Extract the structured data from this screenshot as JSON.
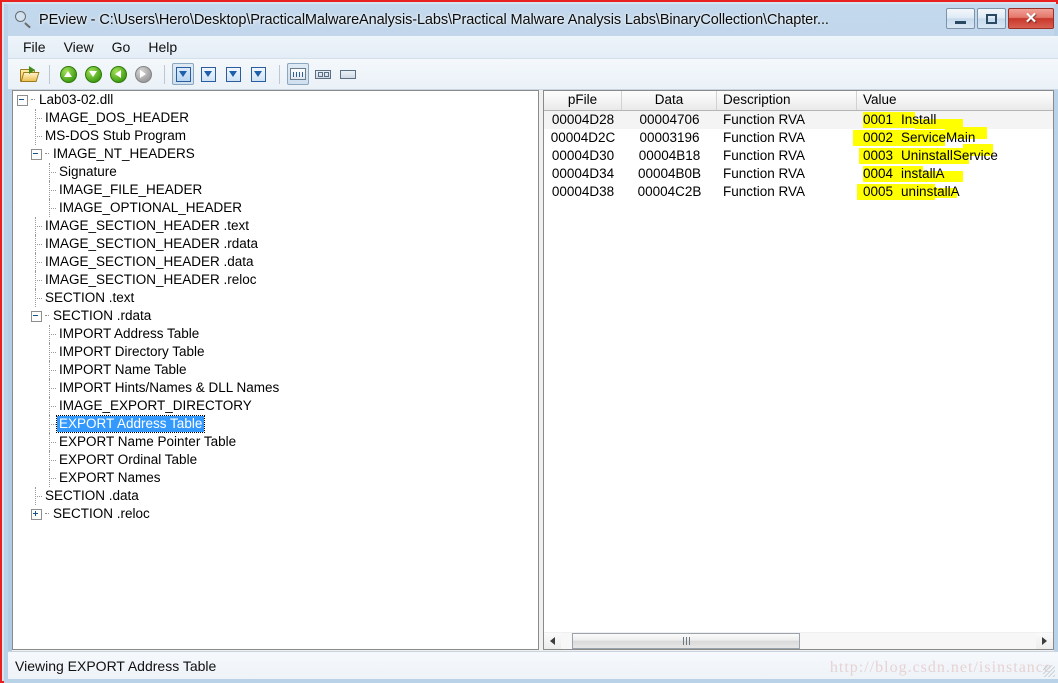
{
  "window": {
    "title": "PEview - C:\\Users\\Hero\\Desktop\\PracticalMalwareAnalysis-Labs\\Practical Malware Analysis Labs\\BinaryCollection\\Chapter...",
    "icon": "magnifier-icon",
    "controls": {
      "minimize": "minimize-button",
      "maximize": "maximize-button",
      "close": "close-button"
    },
    "accent_border": "#e8201e",
    "titlebar_color": "#bcd4e8"
  },
  "menubar": {
    "items": [
      {
        "label": "File"
      },
      {
        "label": "View"
      },
      {
        "label": "Go"
      },
      {
        "label": "Help"
      }
    ]
  },
  "toolbar": {
    "buttons": [
      {
        "name": "open-file-button",
        "icon": "folder-open-icon",
        "state": "enabled"
      },
      {
        "name": "go-up-button",
        "icon": "arrow-up-circle-icon",
        "state": "enabled"
      },
      {
        "name": "go-down-button",
        "icon": "arrow-down-circle-icon",
        "state": "enabled"
      },
      {
        "name": "go-back-button",
        "icon": "arrow-left-circle-icon",
        "state": "enabled"
      },
      {
        "name": "go-forward-button",
        "icon": "arrow-right-circle-icon",
        "state": "disabled"
      },
      {
        "name": "show-header-button",
        "icon": "box-down-arrow-icon",
        "state": "pressed"
      },
      {
        "name": "show-section-button",
        "icon": "box-triangle-down-icon",
        "state": "enabled"
      },
      {
        "name": "show-import-button",
        "icon": "box-down-arrow-small-icon",
        "state": "enabled"
      },
      {
        "name": "show-export-button",
        "icon": "box-down-arrow-alt-icon",
        "state": "enabled"
      },
      {
        "name": "view-detail-button",
        "icon": "list-view-icon",
        "state": "pressed"
      },
      {
        "name": "view-split-button",
        "icon": "split-view-icon",
        "state": "enabled"
      },
      {
        "name": "view-single-button",
        "icon": "single-view-icon",
        "state": "enabled"
      }
    ]
  },
  "tree": {
    "root": "Lab03-02.dll",
    "selected": "EXPORT Address Table",
    "items": [
      {
        "label": "Lab03-02.dll",
        "depth": 0,
        "expander": "minus"
      },
      {
        "label": "IMAGE_DOS_HEADER",
        "depth": 1,
        "expander": "none"
      },
      {
        "label": "MS-DOS Stub Program",
        "depth": 1,
        "expander": "none"
      },
      {
        "label": "IMAGE_NT_HEADERS",
        "depth": 1,
        "expander": "minus"
      },
      {
        "label": "Signature",
        "depth": 2,
        "expander": "none"
      },
      {
        "label": "IMAGE_FILE_HEADER",
        "depth": 2,
        "expander": "none"
      },
      {
        "label": "IMAGE_OPTIONAL_HEADER",
        "depth": 2,
        "expander": "none"
      },
      {
        "label": "IMAGE_SECTION_HEADER .text",
        "depth": 1,
        "expander": "none"
      },
      {
        "label": "IMAGE_SECTION_HEADER .rdata",
        "depth": 1,
        "expander": "none"
      },
      {
        "label": "IMAGE_SECTION_HEADER .data",
        "depth": 1,
        "expander": "none"
      },
      {
        "label": "IMAGE_SECTION_HEADER .reloc",
        "depth": 1,
        "expander": "none"
      },
      {
        "label": "SECTION .text",
        "depth": 1,
        "expander": "none"
      },
      {
        "label": "SECTION .rdata",
        "depth": 1,
        "expander": "minus"
      },
      {
        "label": "IMPORT Address Table",
        "depth": 2,
        "expander": "none"
      },
      {
        "label": "IMPORT Directory Table",
        "depth": 2,
        "expander": "none"
      },
      {
        "label": "IMPORT Name Table",
        "depth": 2,
        "expander": "none"
      },
      {
        "label": "IMPORT Hints/Names & DLL Names",
        "depth": 2,
        "expander": "none"
      },
      {
        "label": "IMAGE_EXPORT_DIRECTORY",
        "depth": 2,
        "expander": "none"
      },
      {
        "label": "EXPORT Address Table",
        "depth": 2,
        "expander": "none",
        "selected": true
      },
      {
        "label": "EXPORT Name Pointer Table",
        "depth": 2,
        "expander": "none"
      },
      {
        "label": "EXPORT Ordinal Table",
        "depth": 2,
        "expander": "none"
      },
      {
        "label": "EXPORT Names",
        "depth": 2,
        "expander": "none"
      },
      {
        "label": "SECTION .data",
        "depth": 1,
        "expander": "none"
      },
      {
        "label": "SECTION .reloc",
        "depth": 1,
        "expander": "plus"
      }
    ]
  },
  "data_table": {
    "columns": [
      "pFile",
      "Data",
      "Description",
      "Value"
    ],
    "rows": [
      {
        "pFile": "00004D28",
        "data": "00004706",
        "description": "Function RVA",
        "ordinal": "0001",
        "name": "Install"
      },
      {
        "pFile": "00004D2C",
        "data": "00003196",
        "description": "Function RVA",
        "ordinal": "0002",
        "name": "ServiceMain"
      },
      {
        "pFile": "00004D30",
        "data": "00004B18",
        "description": "Function RVA",
        "ordinal": "0003",
        "name": "UninstallService"
      },
      {
        "pFile": "00004D34",
        "data": "00004B0B",
        "description": "Function RVA",
        "ordinal": "0004",
        "name": "installA"
      },
      {
        "pFile": "00004D38",
        "data": "00004C2B",
        "description": "Function RVA",
        "ordinal": "0005",
        "name": "uninstallA"
      }
    ],
    "highlight_color": "#ffff00"
  },
  "scrollbar": {
    "left_arrow": "scroll-left-arrow",
    "right_arrow": "scroll-right-arrow",
    "thumb": "scroll-thumb"
  },
  "statusbar": {
    "text": "Viewing EXPORT Address Table",
    "watermark": "http://blog.csdn.net/isinstance"
  }
}
